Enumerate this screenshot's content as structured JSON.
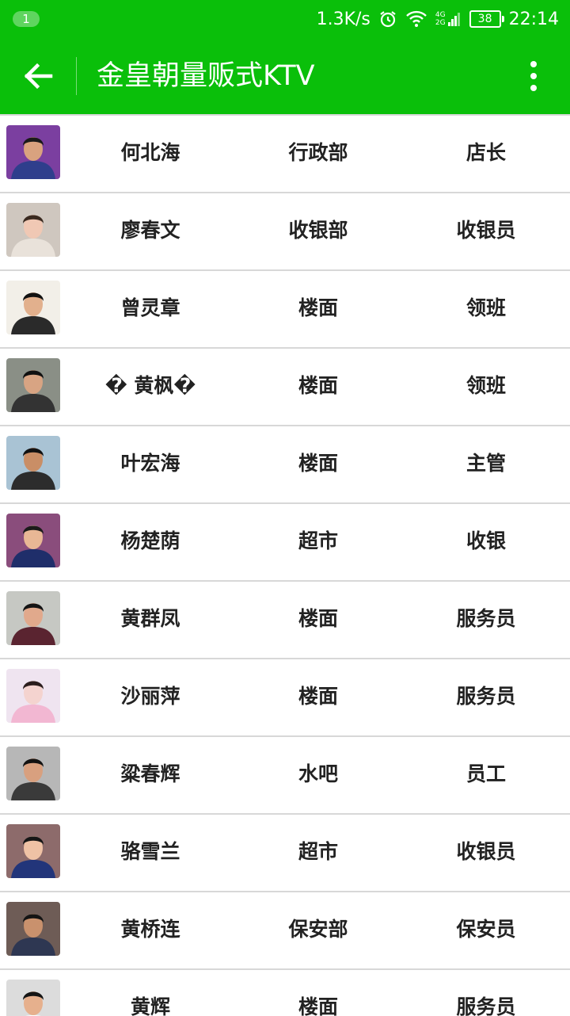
{
  "status_bar": {
    "notification_count": "1",
    "net_speed": "1.3K/s",
    "network_label_top": "4G",
    "network_label_bottom": "2G",
    "battery": "38",
    "time": "22:14"
  },
  "app_bar": {
    "title": "金皇朝量贩式KTV",
    "back_icon": "arrow-left-icon",
    "more_icon": "more-vertical-icon"
  },
  "colors": {
    "primary": "#0abf0a",
    "divider": "#d8d8d8",
    "text": "#222222"
  },
  "employees": [
    {
      "name": "何北海",
      "department": "行政部",
      "position": "店长",
      "avatar_bg": "#7b3fa0",
      "skin": "#d9a27f",
      "hair": "#1a1a1a",
      "shirt": "#2f3e8c"
    },
    {
      "name": "廖春文",
      "department": "收银部",
      "position": "收银员",
      "avatar_bg": "#cfc7bf",
      "skin": "#f0c8b4",
      "hair": "#3a2a20",
      "shirt": "#e9e2da"
    },
    {
      "name": "曾灵章",
      "department": "楼面",
      "position": "领班",
      "avatar_bg": "#f2efe8",
      "skin": "#e2b08d",
      "hair": "#111111",
      "shirt": "#2a2a2a"
    },
    {
      "name": "� 黄枫�",
      "department": "楼面",
      "position": "领班",
      "avatar_bg": "#8a8f86",
      "skin": "#d8a483",
      "hair": "#101010",
      "shirt": "#333333"
    },
    {
      "name": "叶宏海",
      "department": "楼面",
      "position": "主管",
      "avatar_bg": "#a9c3d4",
      "skin": "#c98e66",
      "hair": "#111111",
      "shirt": "#2c2c2c"
    },
    {
      "name": "杨楚荫",
      "department": "超市",
      "position": "收银",
      "avatar_bg": "#8a4d7c",
      "skin": "#e8b795",
      "hair": "#1b1b1b",
      "shirt": "#1f2e6a"
    },
    {
      "name": "黄群凤",
      "department": "楼面",
      "position": "服务员",
      "avatar_bg": "#c6c8c3",
      "skin": "#e1a98c",
      "hair": "#141414",
      "shirt": "#5a2430"
    },
    {
      "name": "沙丽萍",
      "department": "楼面",
      "position": "服务员",
      "avatar_bg": "#efe4f0",
      "skin": "#f4d3cf",
      "hair": "#2b1d1d",
      "shirt": "#f2b7d2"
    },
    {
      "name": "粱春辉",
      "department": "水吧",
      "position": "员工",
      "avatar_bg": "#b7b7b7",
      "skin": "#d8a07f",
      "hair": "#121212",
      "shirt": "#3a3a3a"
    },
    {
      "name": "骆雪兰",
      "department": "超市",
      "position": "收银员",
      "avatar_bg": "#8d6b6b",
      "skin": "#efc2a5",
      "hair": "#161616",
      "shirt": "#22357a"
    },
    {
      "name": "黄桥连",
      "department": "保安部",
      "position": "保安员",
      "avatar_bg": "#6e5c56",
      "skin": "#c9916d",
      "hair": "#141414",
      "shirt": "#2e3752"
    },
    {
      "name": "黄辉",
      "department": "楼面",
      "position": "服务员",
      "avatar_bg": "#dcdcdc",
      "skin": "#e6b08d",
      "hair": "#151515",
      "shirt": "#ffffff"
    }
  ]
}
